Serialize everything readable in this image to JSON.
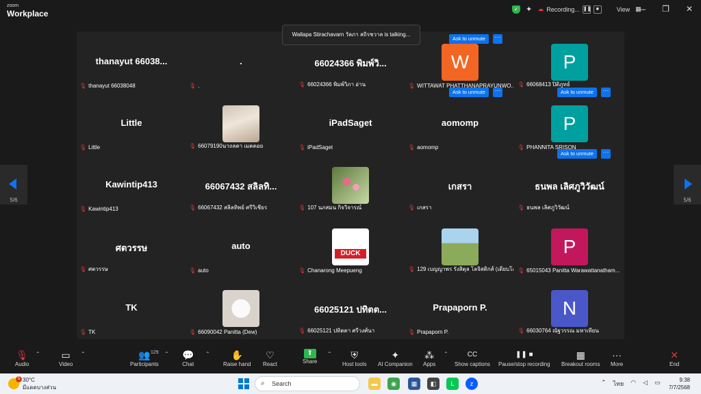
{
  "app": {
    "brand_small": "zoom",
    "brand_large": "Workplace"
  },
  "header": {
    "recording_label": "Recording...",
    "pause_icon": "❚❚",
    "stop_icon": "■",
    "view_label": "View"
  },
  "window_controls": {
    "minimize": "—",
    "maximize": "❐",
    "close": "✕"
  },
  "notification": "Wallapa Stirachavarn วัลภา สถิรชวาล is talking...",
  "colors": {
    "unmute_blue": "#0e72ed",
    "muted_red": "#e0373c",
    "avatar_orange": "#f26522",
    "avatar_teal": "#00a0a0",
    "avatar_magenta": "#c2185b",
    "avatar_indigo": "#4a57c8"
  },
  "unmute_label": "Ask to unmute",
  "more_label": "···",
  "mic_icon": "🎙",
  "participants": [
    {
      "name": "thanayut  66038...",
      "label": "thanayut 66038048"
    },
    {
      "name": ".",
      "label": "."
    },
    {
      "name": "66024366 พิมพ์วิ...",
      "label": "66024366 พิมพ์วิภา อ่าน"
    },
    {
      "avatar": "W",
      "avatar_color": "orange",
      "label": "WITTAWAT PHATTHANAPRAYUNWO...",
      "ask_unmute": true
    },
    {
      "avatar": "P",
      "avatar_color": "teal",
      "label": "66068413 ปิติภูทธ์"
    },
    {
      "name": "Little",
      "label": "Little"
    },
    {
      "photo": "portrait",
      "label": "66079190นาถลดา เมตตอย"
    },
    {
      "name": "iPadSaget",
      "label": "iPadSaget"
    },
    {
      "name": "aomomp",
      "label": "aomomp",
      "ask_unmute": true
    },
    {
      "avatar": "P",
      "avatar_color": "teal",
      "label": "PHANNITA SRISON",
      "ask_unmute": true
    },
    {
      "name": "Kawintip413",
      "label": "Kawintip413"
    },
    {
      "name": "66067432 สลิลทิ...",
      "label": "66067432 สลิลทิพย์ ศรีวิเชียร"
    },
    {
      "photo": "flowers",
      "label": "107 นภสมน กิจวิจารณ์"
    },
    {
      "name": "เกสรา",
      "label": "เกสรา"
    },
    {
      "name": "ธนพล เลิศภูวิวัฒน์",
      "label": "ธนพล เลิศภูวิวัฒน์",
      "ask_unmute": true
    },
    {
      "name": "ศตวรรษ",
      "label": "ศตวรรษ"
    },
    {
      "name": "auto",
      "label": "auto"
    },
    {
      "photo": "duck",
      "photo_text": "DUCK",
      "label": "Chanarong Meepueng"
    },
    {
      "photo": "field",
      "label": "129 เบญญาพร รังสิตุล โลจิสติกส์ (เดียบโอ..."
    },
    {
      "avatar": "P",
      "avatar_color": "magenta",
      "label": "65015043 Panitta Warawattanatham..."
    },
    {
      "name": "TK",
      "label": "TK"
    },
    {
      "photo": "dog",
      "label": "66090042  Panitta (Dew)"
    },
    {
      "name": "66025121 ปทิตต...",
      "label": "66025121 ปทิตตา ศรีวงศ์นา"
    },
    {
      "name": "Prapaporn P.",
      "label": "Prapaporn P."
    },
    {
      "avatar": "N",
      "avatar_color": "indigo",
      "label": "66030764 ณัฐวรรณ มหาเทียน"
    }
  ],
  "pagination": {
    "left": "5/6",
    "right": "5/6"
  },
  "toolbar": [
    {
      "label": "Audio",
      "icon": "mic-off-icon",
      "glyph": "🎙"
    },
    {
      "label": "Video",
      "icon": "video-icon",
      "glyph": "▭"
    },
    {
      "label": "Participants",
      "icon": "participants-icon",
      "glyph": "👥",
      "count": "129"
    },
    {
      "label": "Chat",
      "icon": "chat-icon",
      "glyph": "💬"
    },
    {
      "label": "Raise hand",
      "icon": "hand-icon",
      "glyph": "✋"
    },
    {
      "label": "React",
      "icon": "heart-icon",
      "glyph": "♡"
    },
    {
      "label": "Share",
      "icon": "share-icon",
      "glyph": "⬆"
    },
    {
      "label": "Host tools",
      "icon": "shield-icon",
      "glyph": "⛨"
    },
    {
      "label": "AI Companion",
      "icon": "sparkle-icon",
      "glyph": "✦"
    },
    {
      "label": "Apps",
      "icon": "apps-icon",
      "glyph": "⁂"
    },
    {
      "label": "Show captions",
      "icon": "cc-icon",
      "glyph": "CC"
    },
    {
      "label": "Pause/stop recording",
      "icon": "record-icon",
      "glyph": "❚❚ ■"
    },
    {
      "label": "Breakout rooms",
      "icon": "breakout-icon",
      "glyph": "▦"
    },
    {
      "label": "More",
      "icon": "more-icon",
      "glyph": "···"
    },
    {
      "label": "End",
      "icon": "end-icon",
      "glyph": "✕"
    }
  ],
  "taskbar": {
    "weather_temp": "30°C",
    "weather_desc": "มีแดดบางส่วน",
    "weather_badge": "5",
    "search_placeholder": "Search",
    "lang": "ไทย",
    "time": "9:38",
    "date": "7/7/2568"
  }
}
